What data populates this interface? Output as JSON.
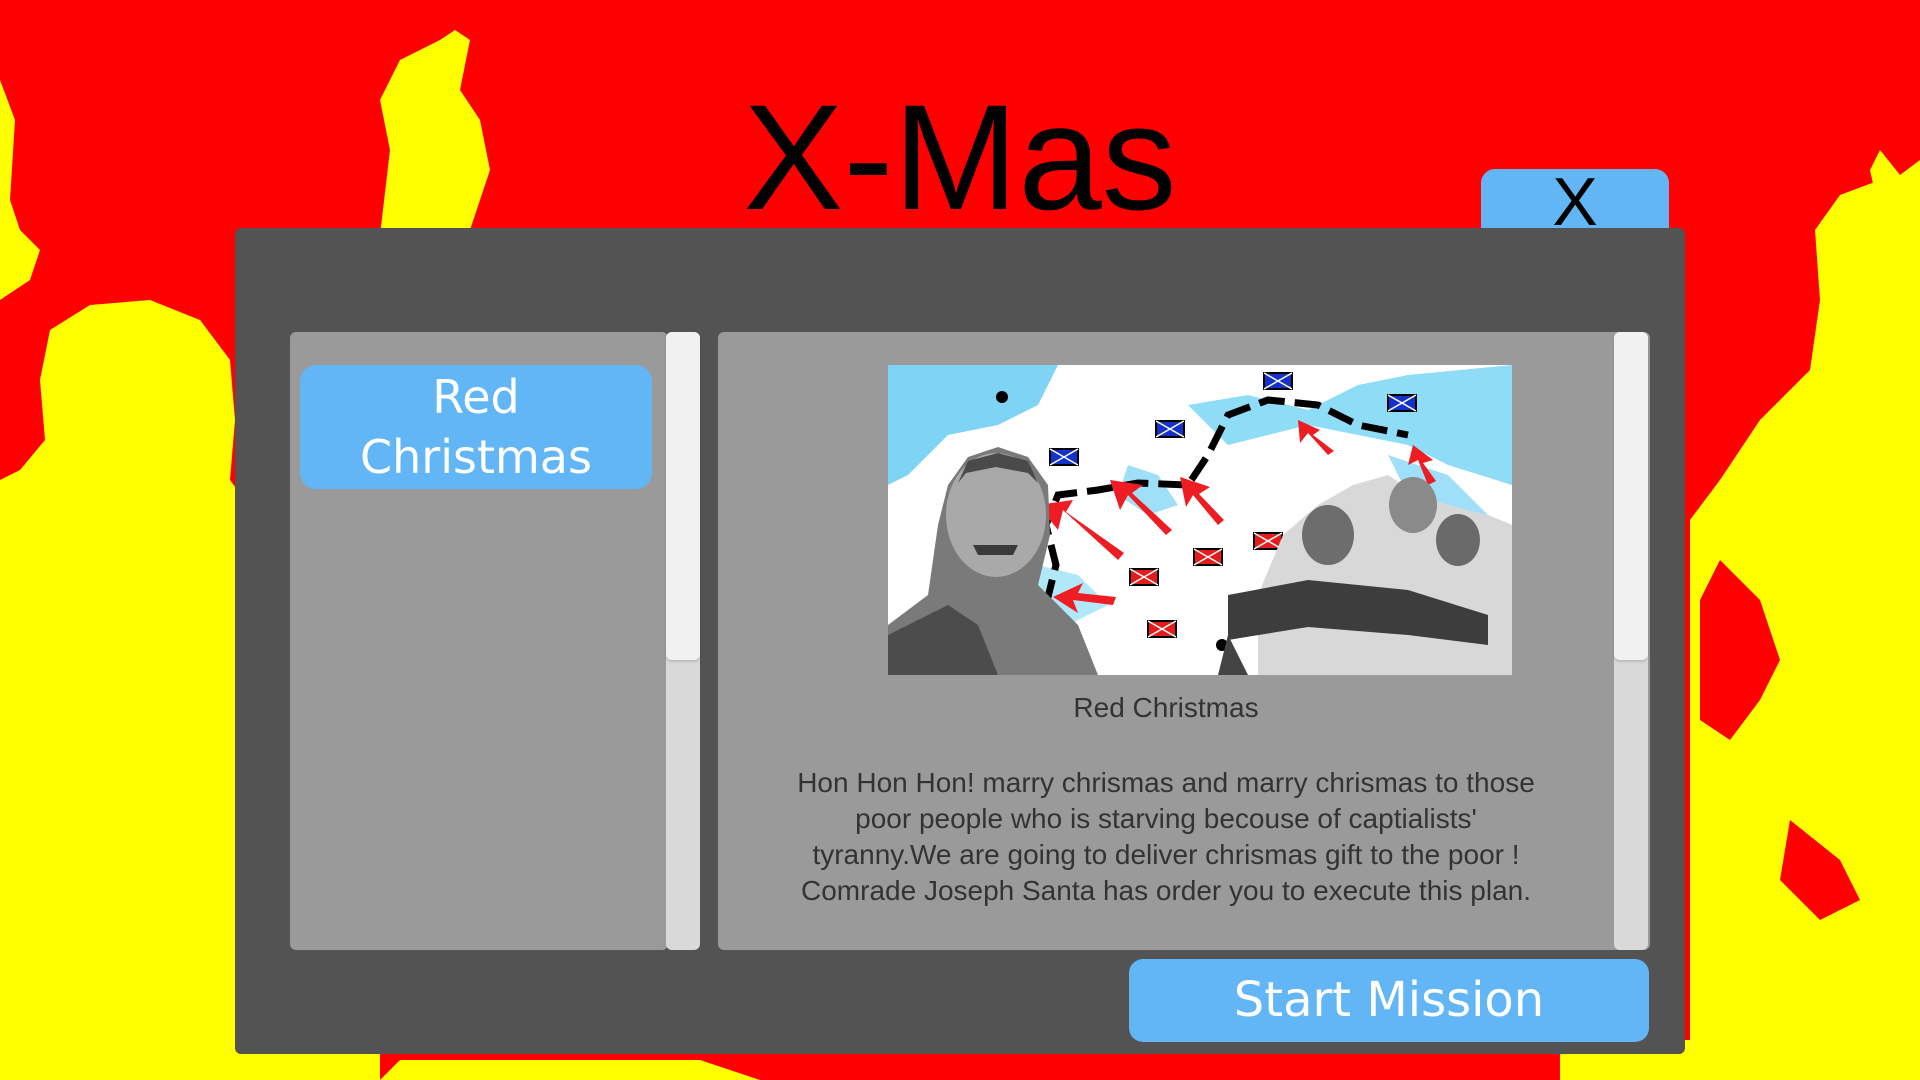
{
  "header": {
    "title": "X-Mas",
    "close_label": "X"
  },
  "mission_list": {
    "items": [
      {
        "label": "Red Christmas",
        "selected": true
      }
    ]
  },
  "mission_detail": {
    "name": "Red Christmas",
    "description": "Hon Hon Hon! marry chrismas and marry chrismas to those poor people who is starving becouse of captialists' tyranny.We are going to deliver chrismas gift to the poor ! Comrade Joseph Santa has order you to execute this plan."
  },
  "actions": {
    "start_label": "Start Mission"
  },
  "colors": {
    "background": "#ff0000",
    "silhouettes": "#ffff00",
    "dialog": "#535353",
    "panel": "#9a9a9a",
    "accent": "#62b6f5"
  },
  "icons": {
    "close": "close-icon"
  }
}
